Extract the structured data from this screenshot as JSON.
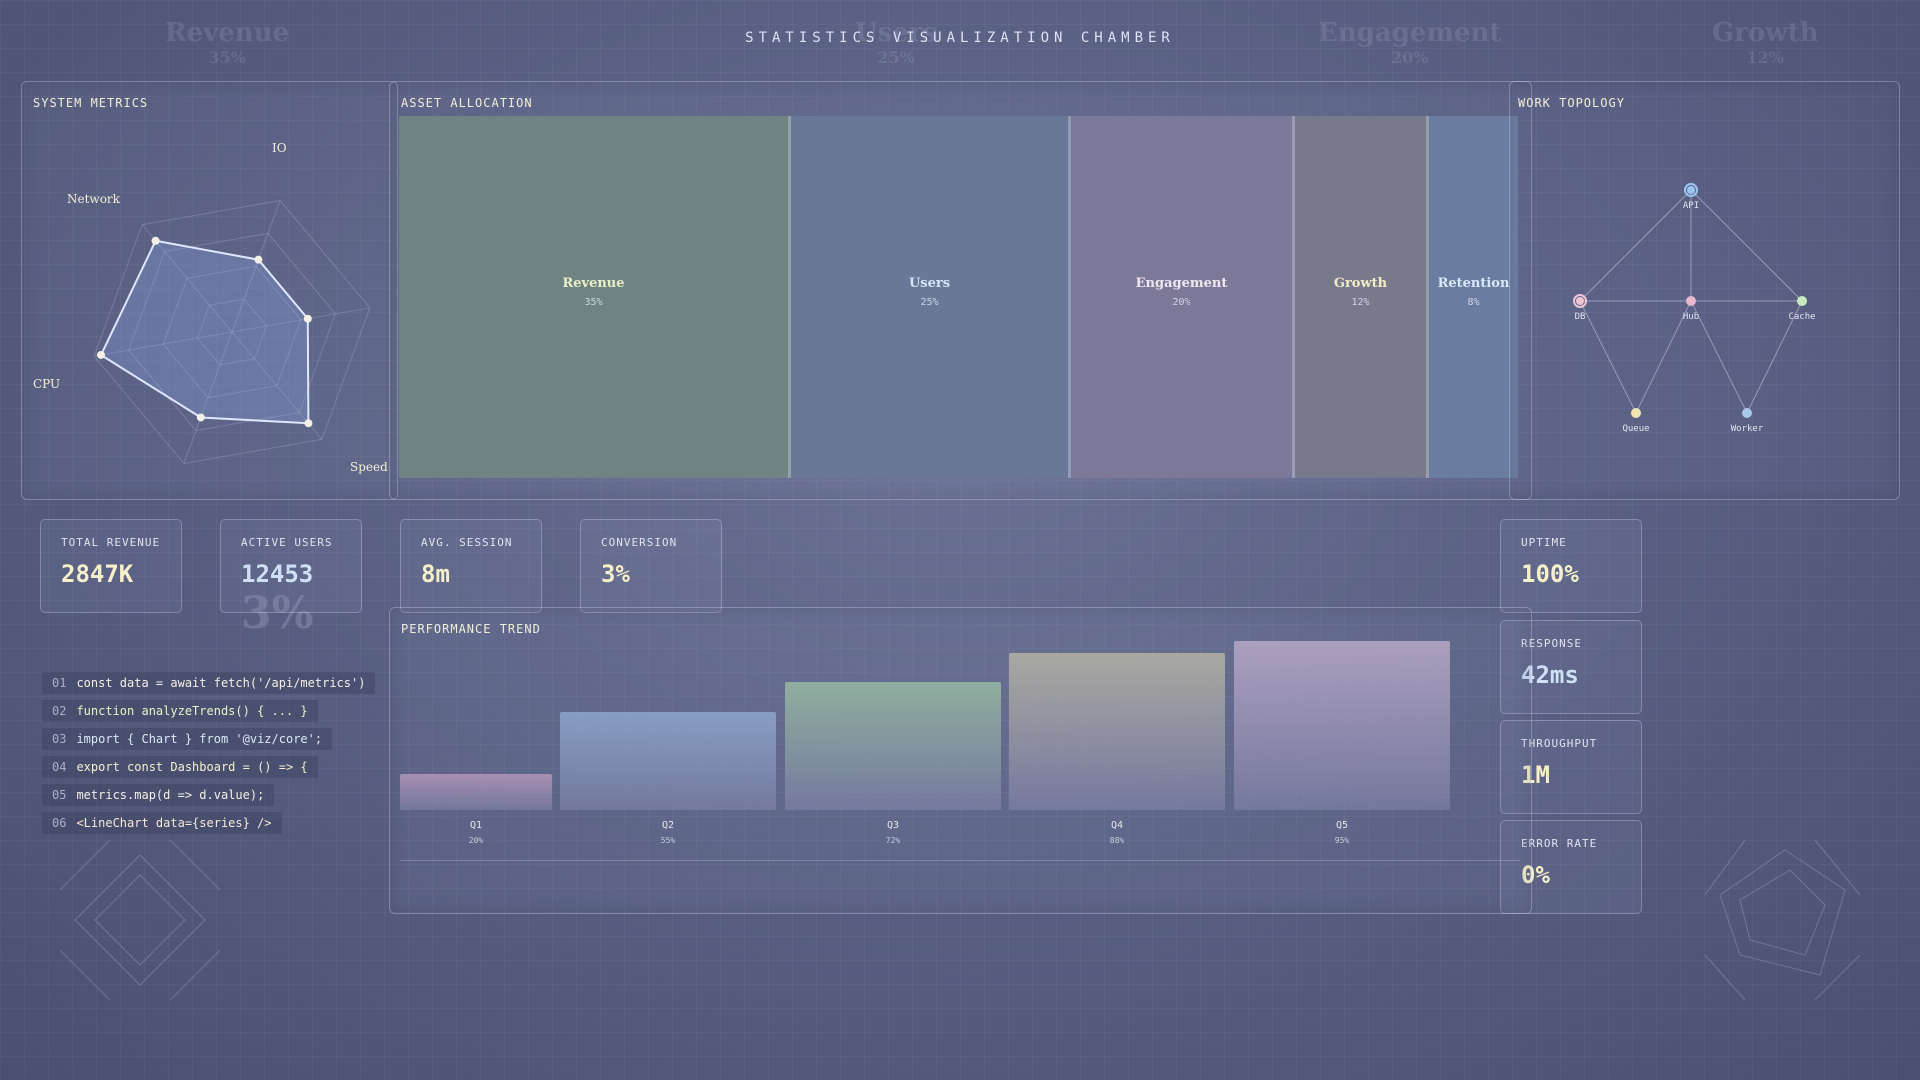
{
  "page_title": "STATISTICS VISUALIZATION CHAMBER",
  "ghost_labels": [
    {
      "label": "Revenue",
      "pct": "35%"
    },
    {
      "label": "Users",
      "pct": "25%"
    },
    {
      "label": "Engagement",
      "pct": "20%"
    },
    {
      "label": "Growth",
      "pct": "12%"
    }
  ],
  "system_metrics": {
    "title": "SYSTEM METRICS",
    "axes": [
      "IO",
      "Network",
      "CPU",
      "Speed"
    ],
    "values": [
      0.55,
      0.55,
      0.85,
      0.65,
      0.95,
      0.85
    ],
    "accent": "#dfe6ff"
  },
  "asset_allocation": {
    "title": "ASSET ALLOCATION",
    "items": [
      {
        "label": "Revenue",
        "pct": "35%",
        "value": 35,
        "color": "#6f8383",
        "text_color": "#e9f0c6"
      },
      {
        "label": "Users",
        "pct": "25%",
        "value": 25,
        "color": "#6a7898",
        "text_color": "#d8e2f6"
      },
      {
        "label": "Engagement",
        "pct": "20%",
        "value": 20,
        "color": "#7c7898",
        "text_color": "#f0e6f0"
      },
      {
        "label": "Growth",
        "pct": "12%",
        "value": 12,
        "color": "#787a8c",
        "text_color": "#f1ecc4"
      },
      {
        "label": "Retention",
        "pct": "8%",
        "value": 8,
        "color": "#6a7da0",
        "text_color": "#d6e8f8"
      }
    ]
  },
  "network_topology": {
    "title": "WORK TOPOLOGY",
    "nodes": [
      {
        "id": "api",
        "label": "API",
        "color": "#9cc4f0"
      },
      {
        "id": "db",
        "label": "DB",
        "color": "#f0c4d4"
      },
      {
        "id": "hub",
        "label": "Hub",
        "color": "#e8b8d0"
      },
      {
        "id": "cache",
        "label": "Cache",
        "color": "#c8ecc0"
      },
      {
        "id": "queue",
        "label": "Queue",
        "color": "#f2e6b0"
      },
      {
        "id": "worker",
        "label": "Worker",
        "color": "#a8c8ec"
      }
    ]
  },
  "metrics_left": [
    {
      "label": "TOTAL REVENUE",
      "value": "2847K"
    },
    {
      "label": "ACTIVE USERS",
      "value": "12453"
    },
    {
      "label": "AVG. SESSION",
      "value": "8m"
    },
    {
      "label": "CONVERSION",
      "value": "3%"
    }
  ],
  "conversion_ghost": "3%",
  "metrics_right": [
    {
      "label": "UPTIME",
      "value": "100%"
    },
    {
      "label": "RESPONSE",
      "value": "42ms"
    },
    {
      "label": "THROUGHPUT",
      "value": "1M"
    },
    {
      "label": "ERROR RATE",
      "value": "0%"
    }
  ],
  "code": [
    {
      "num": "01",
      "text": "const data = await fetch('/api/metrics')"
    },
    {
      "num": "02",
      "text": "function analyzeTrends() { ... }"
    },
    {
      "num": "03",
      "text": "import { Chart } from '@viz/core';"
    },
    {
      "num": "04",
      "text": "export const Dashboard = () => {"
    },
    {
      "num": "05",
      "text": "metrics.map(d => d.value);"
    },
    {
      "num": "06",
      "text": "<LineChart data={series} />"
    }
  ],
  "performance_trend": {
    "title": "PERFORMANCE TREND",
    "chart_data": {
      "type": "bar",
      "categories": [
        "Q1",
        "Q2",
        "Q3",
        "Q4",
        "Q5"
      ],
      "values": [
        20,
        55,
        72,
        88,
        95
      ],
      "value_labels": [
        "20%",
        "55%",
        "72%",
        "88%",
        "95%"
      ],
      "colors": [
        "#b497b8",
        "#8ea6cc",
        "#97baa0",
        "#b4b2a4",
        "#b8a8c6"
      ],
      "ylim": [
        0,
        100
      ]
    }
  }
}
